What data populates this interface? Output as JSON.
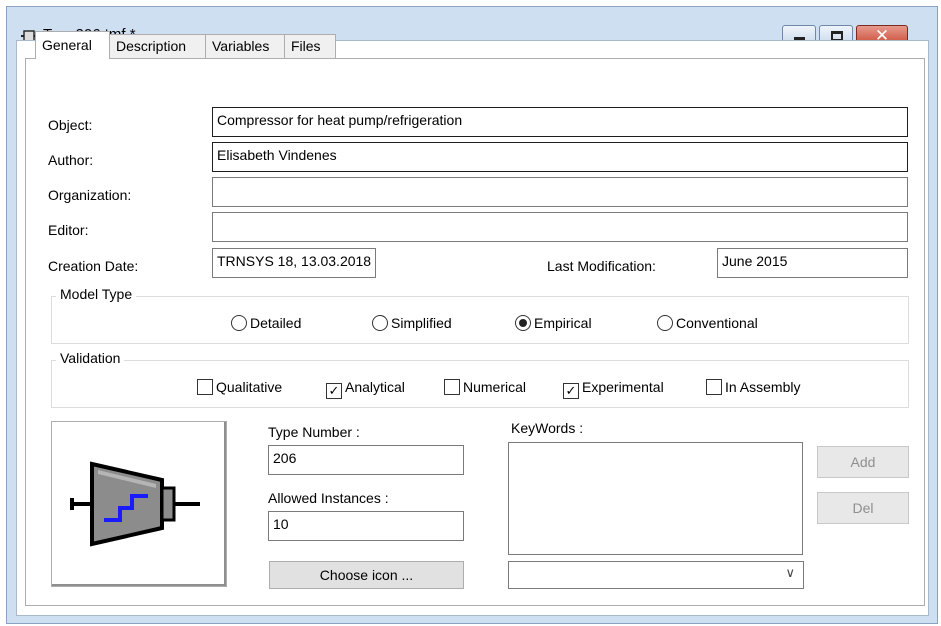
{
  "window": {
    "title": "Type206.tmf *",
    "icon": "component-icon",
    "controls": {
      "minimize": "minimize-icon",
      "maximize": "maximize-icon",
      "close": "✕"
    }
  },
  "tabs": [
    {
      "label": "General",
      "active": true
    },
    {
      "label": "Description",
      "active": false
    },
    {
      "label": "Variables",
      "active": false
    },
    {
      "label": "Files",
      "active": false
    }
  ],
  "general": {
    "object_label": "Object:",
    "object_value": "Compressor for heat pump/refrigeration",
    "author_label": "Author:",
    "author_value": "Elisabeth Vindenes",
    "organization_label": "Organization:",
    "organization_value": "",
    "editor_label": "Editor:",
    "editor_value": "",
    "creation_date_label": "Creation Date:",
    "creation_date_value": "TRNSYS 18, 13.03.2018",
    "last_modification_label": "Last Modification:",
    "last_modification_value": "June 2015"
  },
  "model_type": {
    "title": "Model Type",
    "options": [
      {
        "label": "Detailed",
        "selected": false
      },
      {
        "label": "Simplified",
        "selected": false
      },
      {
        "label": "Empirical",
        "selected": true
      },
      {
        "label": "Conventional",
        "selected": false
      }
    ]
  },
  "validation": {
    "title": "Validation",
    "options": [
      {
        "label": "Qualitative",
        "checked": false
      },
      {
        "label": "Analytical",
        "checked": true
      },
      {
        "label": "Numerical",
        "checked": false
      },
      {
        "label": "Experimental",
        "checked": true
      },
      {
        "label": "In Assembly",
        "checked": false
      }
    ]
  },
  "component": {
    "icon": "compressor-icon",
    "type_number_label": "Type Number :",
    "type_number_value": "206",
    "allowed_instances_label": "Allowed Instances :",
    "allowed_instances_value": "10",
    "choose_icon_label": "Choose icon ...",
    "keywords_label": "KeyWords :",
    "keywords_combo_value": "",
    "add_label": "Add",
    "del_label": "Del"
  },
  "colors": {
    "window_frame": "#cfdff2",
    "close_button": "#c8462f",
    "icon_fill": "#8c8c8c",
    "icon_accent": "#1a1aff"
  }
}
